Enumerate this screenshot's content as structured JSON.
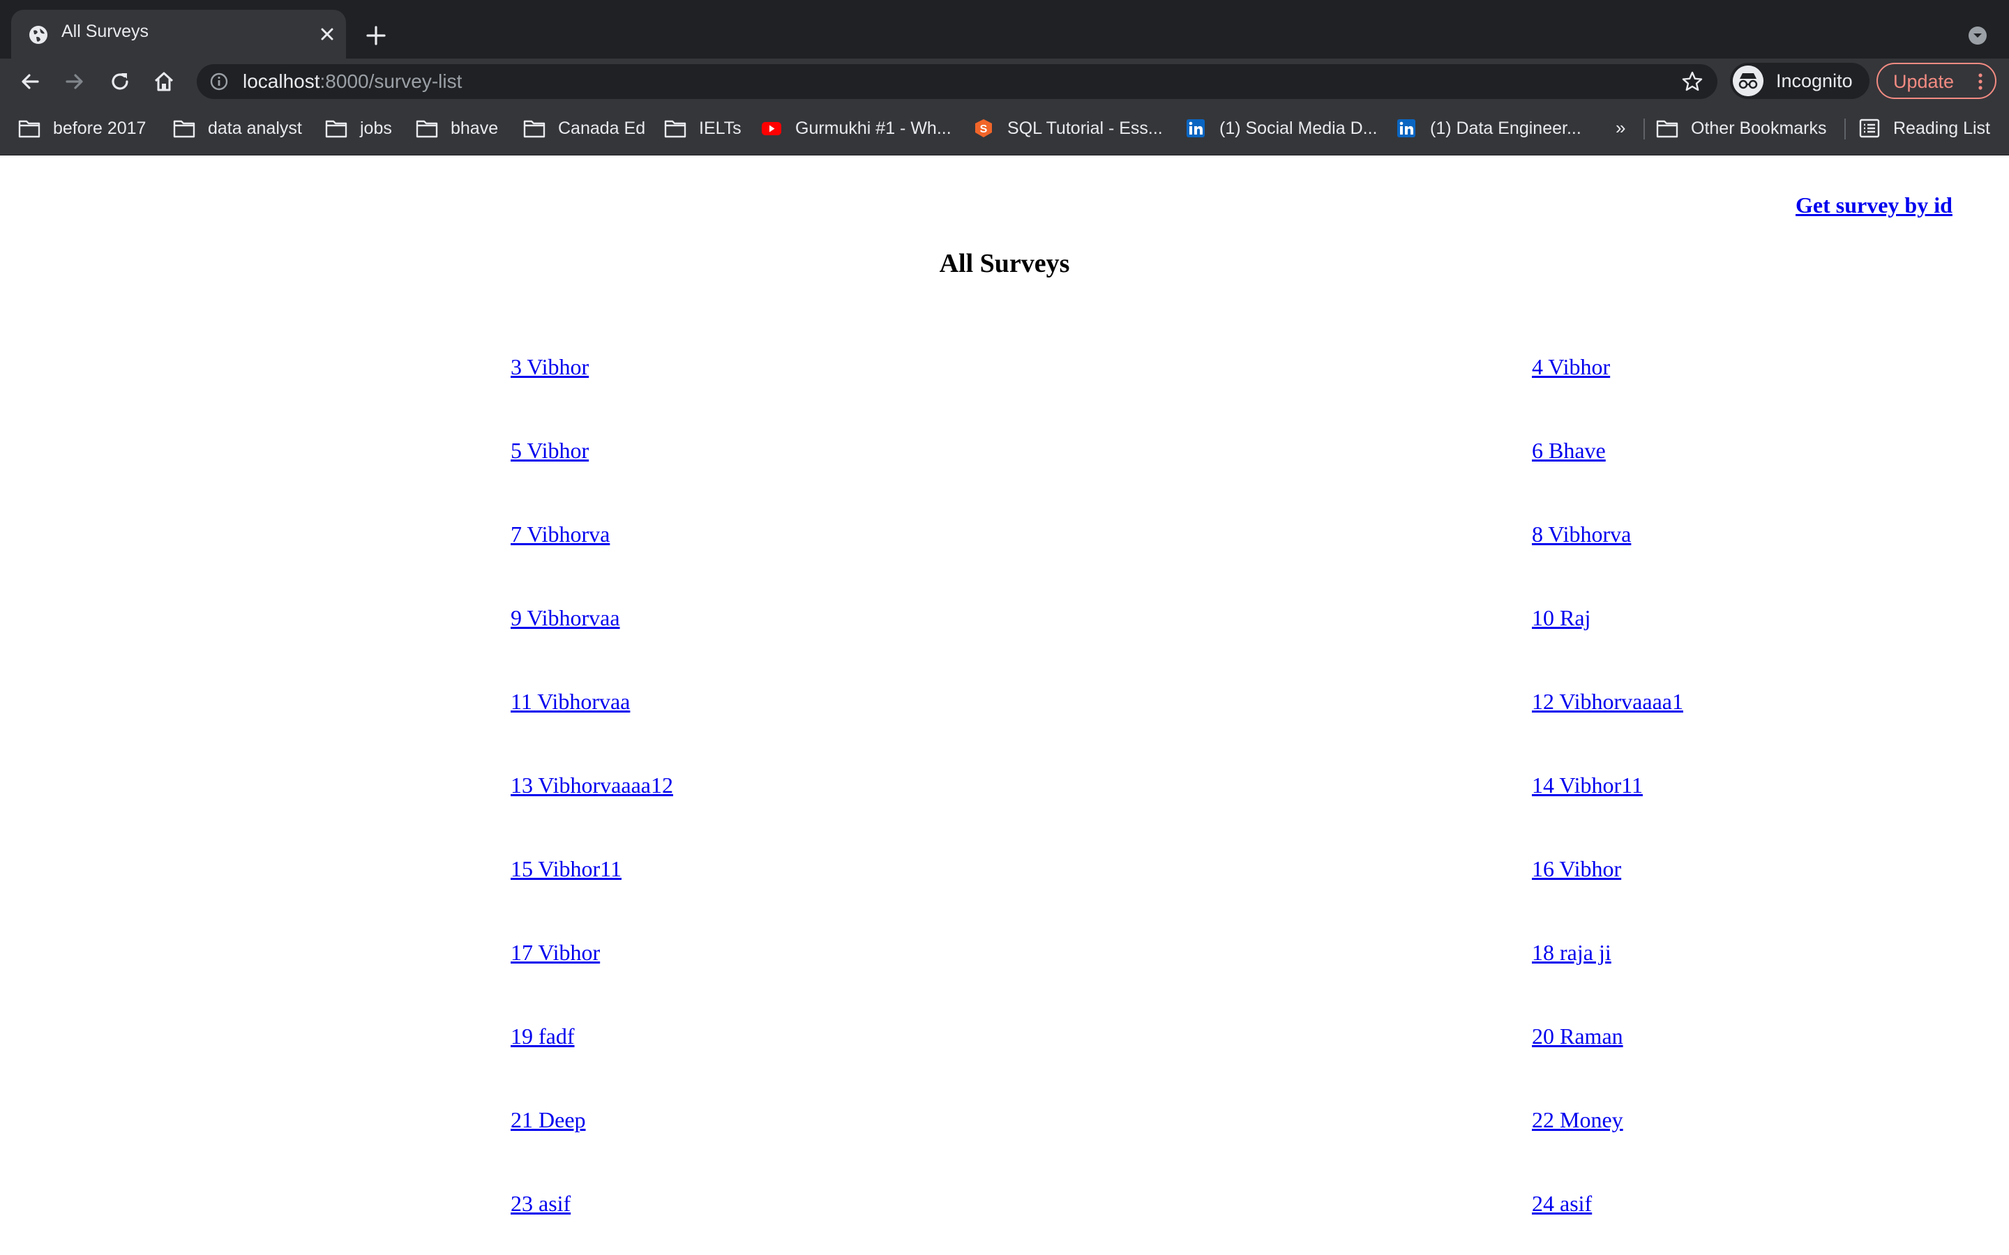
{
  "tab": {
    "title": "All Surveys"
  },
  "address_bar": {
    "host": "localhost",
    "path": ":8000/survey-list"
  },
  "profile": {
    "label": "Incognito"
  },
  "update_button": {
    "label": "Update"
  },
  "bookmarks": [
    {
      "label": "before  2017",
      "icon": "folder-icon"
    },
    {
      "label": "data analyst",
      "icon": "folder-icon"
    },
    {
      "label": "jobs",
      "icon": "folder-icon"
    },
    {
      "label": "bhave",
      "icon": "folder-icon"
    },
    {
      "label": "Canada Ed",
      "icon": "folder-icon"
    },
    {
      "label": "IELTs",
      "icon": "folder-icon"
    },
    {
      "label": "Gurmukhi #1 - Wh...",
      "icon": "youtube-icon"
    },
    {
      "label": "SQL Tutorial - Ess...",
      "icon": "sql-icon"
    },
    {
      "label": "(1) Social Media D...",
      "icon": "linkedin-icon"
    },
    {
      "label": "(1) Data Engineer...",
      "icon": "linkedin-icon"
    }
  ],
  "bookmarks_overflow": "»",
  "other_bookmarks": "Other Bookmarks",
  "reading_list": "Reading List",
  "page": {
    "get_by_id_link": "Get survey by id",
    "heading": "All Surveys",
    "surveys": [
      "3 Vibhor",
      "4 Vibhor",
      "5 Vibhor",
      "6 Bhave",
      "7 Vibhorva",
      "8 Vibhorva",
      "9 Vibhorvaa",
      "10 Raj",
      "11 Vibhorvaa",
      "12 Vibhorvaaaa1",
      "13 Vibhorvaaaa12",
      "14 Vibhor11",
      "15 Vibhor11",
      "16 Vibhor",
      "17 Vibhor",
      "18 raja ji",
      "19 fadf",
      "20 Raman",
      "21 Deep",
      "22 Money",
      "23 asif",
      "24 asif"
    ]
  },
  "colors": {
    "link": "#0000ee",
    "chrome_dark": "#202124",
    "chrome_mid": "#35363a",
    "update_accent": "#f28b82"
  }
}
